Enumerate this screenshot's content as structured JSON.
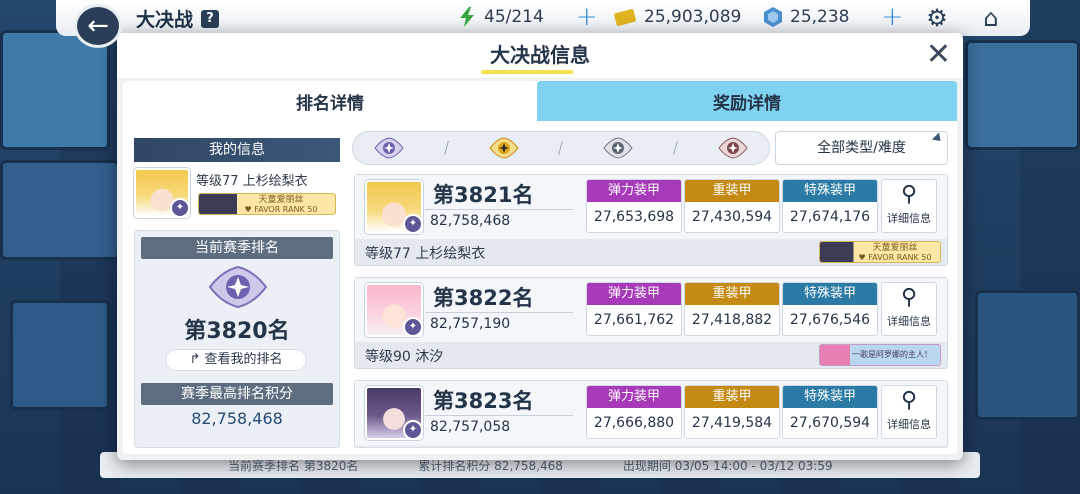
{
  "topbar": {
    "title": "大决战",
    "help_label": "?",
    "stamina": "45/214",
    "credits": "25,903,089",
    "gems": "25,238",
    "colors": {
      "stamina": "#3aa640",
      "credits": "#e0b420",
      "gems": "#4a8ed0",
      "plus": "#2f8ad8"
    }
  },
  "modal": {
    "title": "大决战信息",
    "tabs": [
      {
        "label": "排名详情",
        "active": true
      },
      {
        "label": "奖励详情",
        "active": false
      }
    ],
    "my_info": {
      "header": "我的信息",
      "level_name": "等级77 上杉绘梨衣",
      "favor_badge": "天童爱丽丝",
      "favor_rank": "♥ FAVOR RANK 50",
      "current_rank_header": "当前赛季排名",
      "current_rank": "第3820名",
      "view_my_rank": "查看我的排名",
      "season_best_header": "赛季最高排名积分",
      "season_best_score": "82,758,468"
    },
    "filter": {
      "difficulty_icons": [
        "purple-rank-icon",
        "gold-rank-icon",
        "gray-rank-icon",
        "rose-rank-icon"
      ],
      "type_dropdown": "全部类型/难度"
    },
    "armor_labels": {
      "elastic": "弹力装甲",
      "heavy": "重装甲",
      "special": "特殊装甲"
    },
    "detail_label": "详细信息",
    "ranks": [
      {
        "rank": "第3821名",
        "score": "82,758,468",
        "elastic": "27,653,698",
        "heavy": "27,430,594",
        "special": "27,674,176",
        "level_name": "等级77 上杉绘梨衣",
        "badge_name": "天童爱丽丝",
        "badge_sub": "♥ FAVOR RANK 50"
      },
      {
        "rank": "第3822名",
        "score": "82,757,190",
        "elastic": "27,661,762",
        "heavy": "27,418,882",
        "special": "27,676,546",
        "level_name": "等级90 沐汐",
        "badge_name": "一歌是阿罗娜的主人！"
      },
      {
        "rank": "第3823名",
        "score": "82,757,058",
        "elastic": "27,666,880",
        "heavy": "27,419,584",
        "special": "27,670,594"
      }
    ]
  },
  "bottom_strip": {
    "season_rank": "当前赛季排名 第3820名",
    "total_score": "累计排名积分 82,758,468",
    "period": "出现期间 03/05 14:00 - 03/12 03:59"
  }
}
